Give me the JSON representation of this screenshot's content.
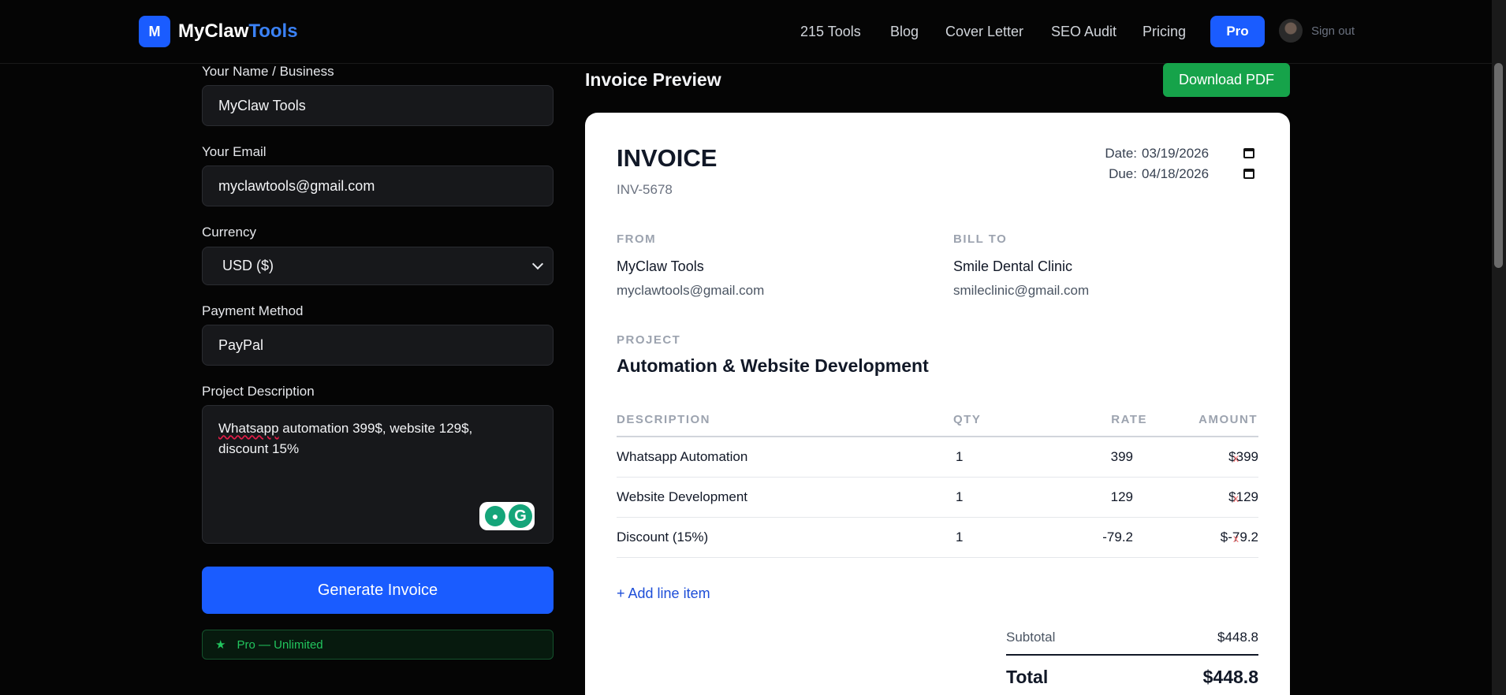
{
  "header": {
    "logo_letter": "M",
    "brand_main": "MyClaw",
    "brand_accent": "Tools",
    "nav": [
      "215 Tools",
      "Blog",
      "Cover Letter",
      "SEO Audit",
      "Pricing"
    ],
    "pro_label": "Pro",
    "signout_label": "Sign out"
  },
  "form": {
    "name_label": "Your Name / Business",
    "name_value": "MyClaw Tools",
    "email_label": "Your Email",
    "email_value": "myclawtools@gmail.com",
    "currency_label": "Currency",
    "currency_value": "USD ($)",
    "payment_label": "Payment Method",
    "payment_value": "PayPal",
    "project_label": "Project Description",
    "project_word1": "Whatsapp",
    "project_rest_line1": " automation 399$, website 129$,",
    "project_line2": "discount 15%",
    "generate_label": "Generate Invoice",
    "pro_badge_star": "★",
    "pro_badge_text": "Pro — Unlimited"
  },
  "preview": {
    "title": "Invoice Preview",
    "download_label": "Download PDF",
    "invoice_title": "INVOICE",
    "invoice_number": "INV-5678",
    "date_label": "Date:",
    "date_value": "03/19/2026",
    "due_label": "Due:",
    "due_value": "04/18/2026",
    "from_label": "FROM",
    "from_name": "MyClaw Tools",
    "from_email": "myclawtools@gmail.com",
    "billto_label": "BILL TO",
    "billto_name": "Smile Dental Clinic",
    "billto_email": "smileclinic@gmail.com",
    "project_label": "PROJECT",
    "project_name": "Automation & Website Development",
    "columns": {
      "description": "DESCRIPTION",
      "qty": "QTY",
      "rate": "RATE",
      "amount": "AMOUNT"
    },
    "items": [
      {
        "description": "Whatsapp Automation",
        "qty": "1",
        "rate": "399",
        "amount": "$399",
        "remove": "x"
      },
      {
        "description": "Website Development",
        "qty": "1",
        "rate": "129",
        "amount": "$129",
        "remove": "x"
      },
      {
        "description": "Discount (15%)",
        "qty": "1",
        "rate": "-79.2",
        "amount": "$-79.2",
        "remove": "x"
      }
    ],
    "add_line_label": "+ Add line item",
    "subtotal_label": "Subtotal",
    "subtotal_value": "$448.8",
    "total_label": "Total",
    "total_value": "$448.8"
  }
}
